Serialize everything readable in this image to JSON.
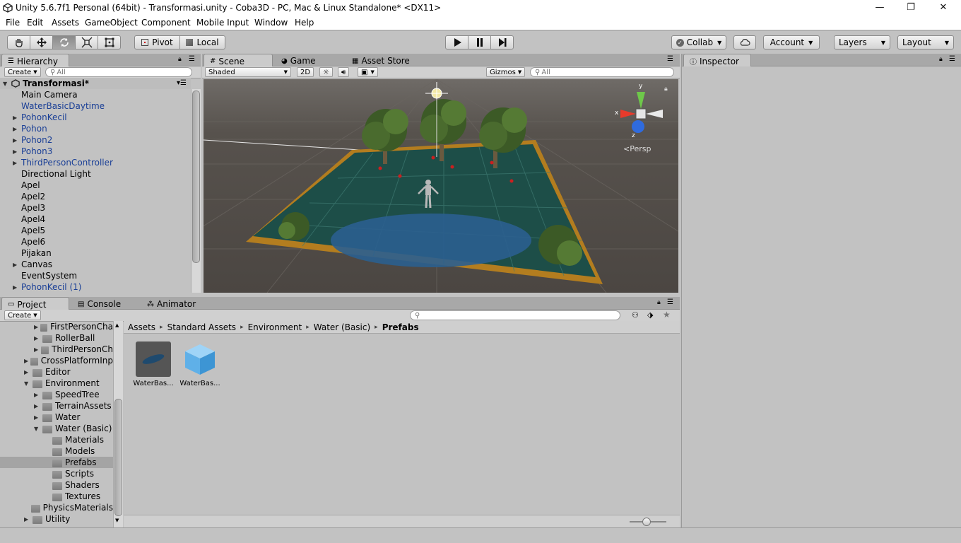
{
  "window": {
    "title": "Unity 5.6.7f1 Personal (64bit) - Transformasi.unity - Coba3D - PC, Mac & Linux Standalone* <DX11>",
    "controls": [
      "—",
      "❐",
      "✕"
    ]
  },
  "menus": [
    "File",
    "Edit",
    "Assets",
    "GameObject",
    "Component",
    "Mobile Input",
    "Window",
    "Help"
  ],
  "toolbar": {
    "pivot": "Pivot",
    "local": "Local",
    "collab": "Collab",
    "account": "Account",
    "layers": "Layers",
    "layout": "Layout"
  },
  "hierarchy": {
    "tab": "Hierarchy",
    "create": "Create",
    "search_placeholder": "All",
    "scene": "Transformasi*",
    "items": [
      {
        "label": "Main Camera",
        "blue": false,
        "expandable": false
      },
      {
        "label": "WaterBasicDaytime",
        "blue": true,
        "expandable": false
      },
      {
        "label": "PohonKecil",
        "blue": true,
        "expandable": true
      },
      {
        "label": "Pohon",
        "blue": true,
        "expandable": true
      },
      {
        "label": "Pohon2",
        "blue": true,
        "expandable": true
      },
      {
        "label": "Pohon3",
        "blue": true,
        "expandable": true
      },
      {
        "label": "ThirdPersonController",
        "blue": true,
        "expandable": true
      },
      {
        "label": "Directional Light",
        "blue": false,
        "expandable": false
      },
      {
        "label": "Apel",
        "blue": false,
        "expandable": false
      },
      {
        "label": "Apel2",
        "blue": false,
        "expandable": false
      },
      {
        "label": "Apel3",
        "blue": false,
        "expandable": false
      },
      {
        "label": "Apel4",
        "blue": false,
        "expandable": false
      },
      {
        "label": "Apel5",
        "blue": false,
        "expandable": false
      },
      {
        "label": "Apel6",
        "blue": false,
        "expandable": false
      },
      {
        "label": "Pijakan",
        "blue": false,
        "expandable": false
      },
      {
        "label": "Canvas",
        "blue": false,
        "expandable": true
      },
      {
        "label": "EventSystem",
        "blue": false,
        "expandable": false
      },
      {
        "label": "PohonKecil (1)",
        "blue": true,
        "expandable": true
      }
    ]
  },
  "scene": {
    "tabs": [
      "Scene",
      "Game",
      "Asset Store"
    ],
    "shading": "Shaded",
    "mode2d": "2D",
    "gizmos": "Gizmos",
    "search_placeholder": "All",
    "persp": "Persp",
    "axis_x": "x",
    "axis_y": "y",
    "axis_z": "z"
  },
  "inspector": {
    "tab": "Inspector"
  },
  "project": {
    "tabs": [
      "Project",
      "Console",
      "Animator"
    ],
    "create": "Create",
    "breadcrumb": [
      "Assets",
      "Standard Assets",
      "Environment",
      "Water (Basic)",
      "Prefabs"
    ],
    "tree": [
      {
        "label": "FirstPersonCha",
        "indent": 2,
        "expandable": true,
        "selected": false
      },
      {
        "label": "RollerBall",
        "indent": 2,
        "expandable": true,
        "selected": false
      },
      {
        "label": "ThirdPersonCh",
        "indent": 2,
        "expandable": true,
        "selected": false
      },
      {
        "label": "CrossPlatformInp",
        "indent": 1,
        "expandable": true,
        "selected": false
      },
      {
        "label": "Editor",
        "indent": 1,
        "expandable": true,
        "selected": false
      },
      {
        "label": "Environment",
        "indent": 1,
        "expandable": true,
        "open": true,
        "selected": false
      },
      {
        "label": "SpeedTree",
        "indent": 2,
        "expandable": true,
        "selected": false
      },
      {
        "label": "TerrainAssets",
        "indent": 2,
        "expandable": true,
        "selected": false
      },
      {
        "label": "Water",
        "indent": 2,
        "expandable": true,
        "selected": false
      },
      {
        "label": "Water (Basic)",
        "indent": 2,
        "expandable": true,
        "open": true,
        "selected": false
      },
      {
        "label": "Materials",
        "indent": 3,
        "expandable": false,
        "selected": false
      },
      {
        "label": "Models",
        "indent": 3,
        "expandable": false,
        "selected": false
      },
      {
        "label": "Prefabs",
        "indent": 3,
        "expandable": false,
        "selected": true
      },
      {
        "label": "Scripts",
        "indent": 3,
        "expandable": false,
        "selected": false
      },
      {
        "label": "Shaders",
        "indent": 3,
        "expandable": false,
        "selected": false
      },
      {
        "label": "Textures",
        "indent": 3,
        "expandable": false,
        "selected": false
      },
      {
        "label": "PhysicsMaterials",
        "indent": 1,
        "expandable": false,
        "selected": false
      },
      {
        "label": "Utility",
        "indent": 1,
        "expandable": true,
        "selected": false
      }
    ],
    "assets": [
      {
        "label": "WaterBas...",
        "kind": "water-plane"
      },
      {
        "label": "WaterBas...",
        "kind": "cube"
      }
    ]
  },
  "colors": {
    "panel_bg": "#c2c2c2",
    "tab_header": "#a8a8a8",
    "hierarchy_blue": "#1a3f96",
    "terrain_green": "#1d4e48",
    "terrain_border": "#c08a28",
    "water": "#2b5f8f"
  }
}
